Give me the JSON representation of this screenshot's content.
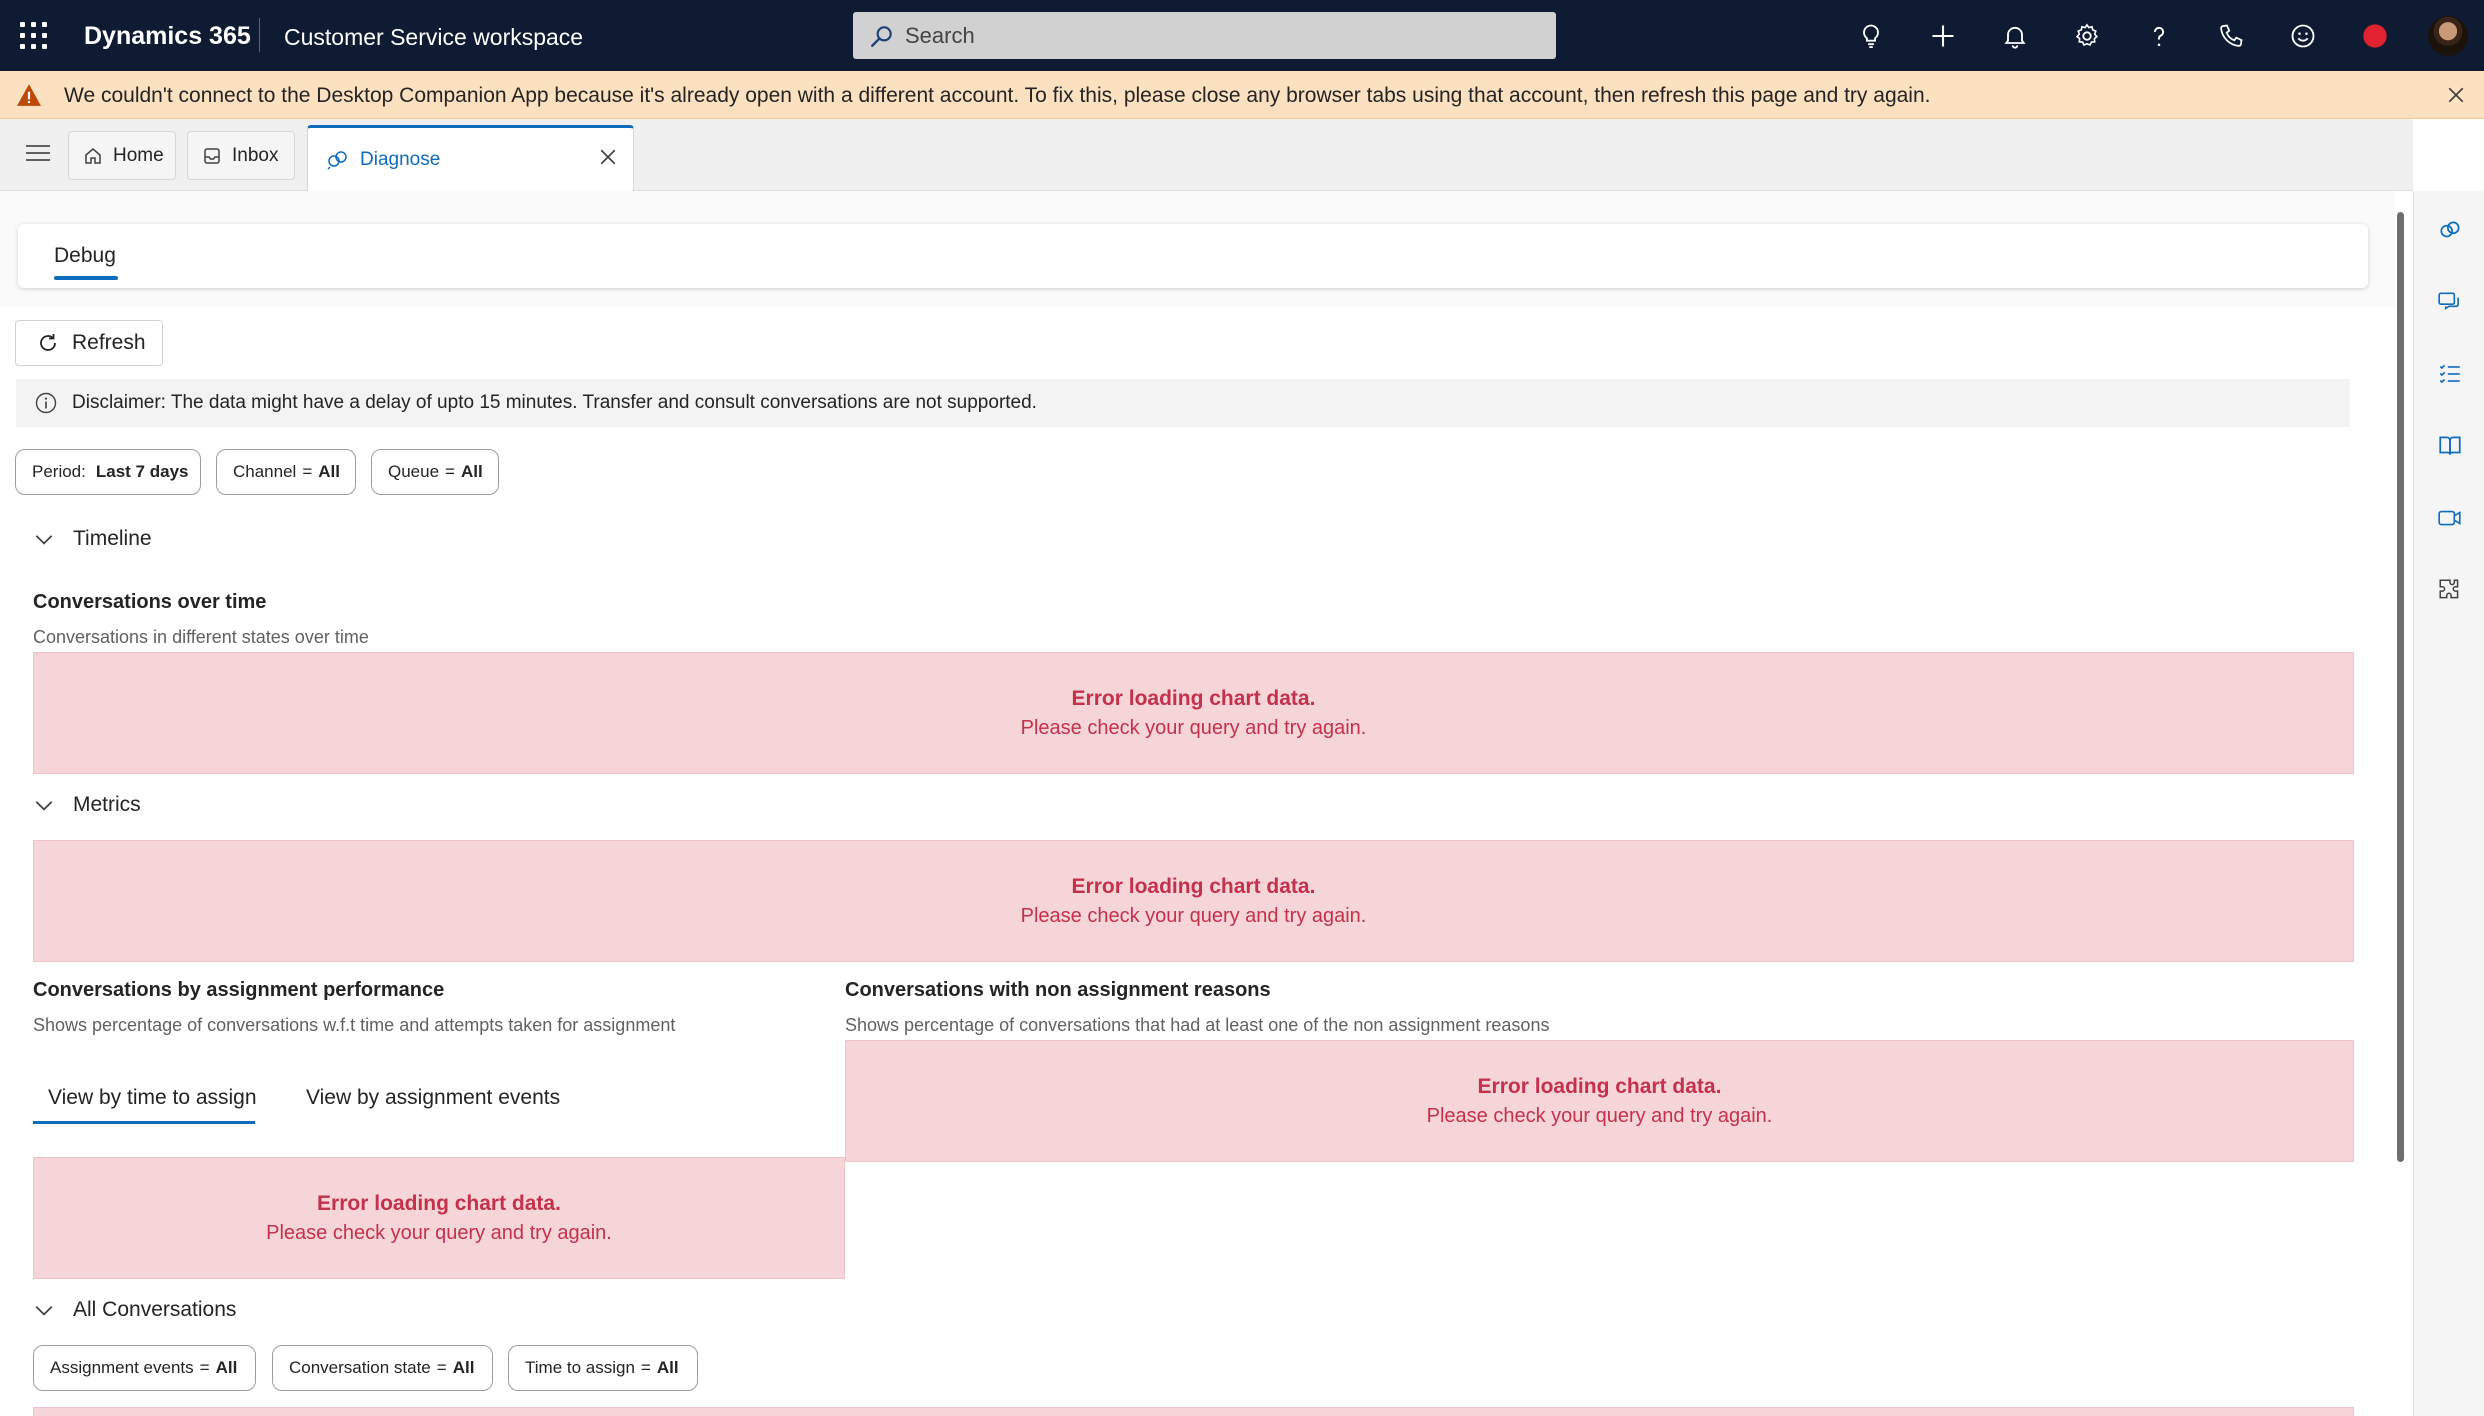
{
  "topbar": {
    "brand": "Dynamics 365",
    "app_name": "Customer Service workspace",
    "search_placeholder": "Search",
    "icons": [
      "lightbulb-icon",
      "plus-icon",
      "bell-icon",
      "gear-icon",
      "help-icon",
      "phone-icon",
      "smiley-icon",
      "presence-busy-icon",
      "user-avatar"
    ]
  },
  "banner": {
    "message": "We couldn't connect to the Desktop Companion App because it's already open with a different account. To fix this, please close any browser tabs using that account, then refresh this page and try again."
  },
  "tabs": [
    {
      "label": "Home",
      "icon": "home-icon"
    },
    {
      "label": "Inbox",
      "icon": "inbox-icon"
    },
    {
      "label": "Diagnose",
      "icon": "diagnose-icon",
      "active": true
    }
  ],
  "page": {
    "debug_tab": "Debug",
    "refresh_label": "Refresh",
    "disclaimer": "Disclaimer: The data might have a delay of upto 15 minutes. Transfer and consult conversations are not supported.",
    "filters": {
      "period": {
        "key": "Period:",
        "value": "Last 7 days"
      },
      "channel": {
        "key": "Channel",
        "eq": "=",
        "value": "All"
      },
      "queue": {
        "key": "Queue",
        "eq": "=",
        "value": "All"
      }
    },
    "sections": {
      "timeline": "Timeline",
      "metrics": "Metrics",
      "all_conversations": "All Conversations"
    },
    "conv_over_time": {
      "title": "Conversations over time",
      "subtitle": "Conversations in different states over time"
    },
    "assignment_perf": {
      "title": "Conversations by assignment performance",
      "subtitle": "Shows percentage of conversations w.f.t time and attempts taken for assignment",
      "tab_time": "View by time to assign",
      "tab_events": "View by assignment events"
    },
    "non_assignment": {
      "title": "Conversations with non assignment reasons",
      "subtitle": "Shows percentage of conversations that had at least one of the non assignment reasons"
    },
    "error": {
      "line1": "Error loading chart data.",
      "line2": "Please check your query and try again."
    },
    "conv_filters": {
      "assignment_events": {
        "key": "Assignment events",
        "eq": "=",
        "value": "All"
      },
      "conversation_state": {
        "key": "Conversation state",
        "eq": "=",
        "value": "All"
      },
      "time_to_assign": {
        "key": "Time to assign",
        "eq": "=",
        "value": "All"
      }
    }
  },
  "colors": {
    "topbar": "#0f1b33",
    "banner": "#fce1c1",
    "accent": "#0f6cbd",
    "error_bg": "#f6d5d8",
    "error_text": "#c4314b"
  }
}
